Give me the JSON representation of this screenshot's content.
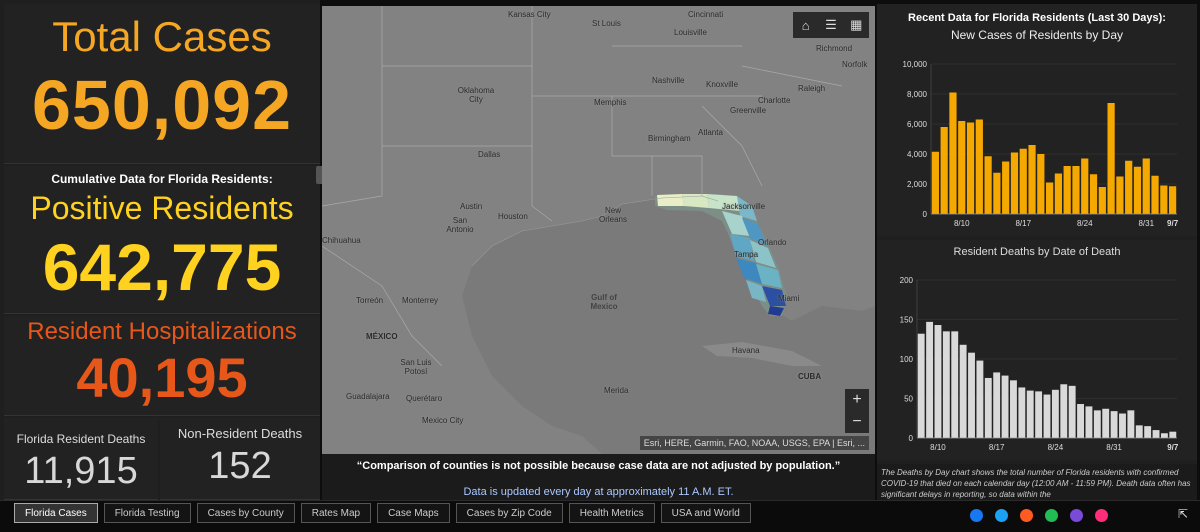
{
  "left": {
    "total_cases_label": "Total Cases",
    "total_cases_value": "650,092",
    "cumulative_label": "Cumulative Data for Florida Residents:",
    "positive_label": "Positive Residents",
    "positive_value": "642,775",
    "hosp_label": "Resident Hospitalizations",
    "hosp_value": "40,195",
    "fl_deaths_label": "Florida Resident Deaths",
    "fl_deaths_value": "11,915",
    "nonres_deaths_label": "Non-Resident Deaths",
    "nonres_deaths_value": "152"
  },
  "map": {
    "cities": [
      {
        "name": "Kansas City"
      },
      {
        "name": "St Louis"
      },
      {
        "name": "Cincinnati"
      },
      {
        "name": "Louisville"
      },
      {
        "name": "Richmond"
      },
      {
        "name": "Norfolk"
      },
      {
        "name": "Nashville"
      },
      {
        "name": "Knoxville"
      },
      {
        "name": "Raleigh"
      },
      {
        "name": "Charlotte"
      },
      {
        "name": "Greenville"
      },
      {
        "name": "Oklahoma City"
      },
      {
        "name": "Memphis"
      },
      {
        "name": "Birmingham"
      },
      {
        "name": "Atlanta"
      },
      {
        "name": "Dallas"
      },
      {
        "name": "Austin"
      },
      {
        "name": "Houston"
      },
      {
        "name": "San Antonio"
      },
      {
        "name": "New Orleans"
      },
      {
        "name": "Jacksonville"
      },
      {
        "name": "Orlando"
      },
      {
        "name": "Tampa"
      },
      {
        "name": "Miami"
      },
      {
        "name": "Torreón"
      },
      {
        "name": "Monterrey"
      },
      {
        "name": "MÉXICO"
      },
      {
        "name": "San Luis Potosí"
      },
      {
        "name": "Guadalajara"
      },
      {
        "name": "Querétaro"
      },
      {
        "name": "Mexico City"
      },
      {
        "name": "Havana"
      },
      {
        "name": "Merida"
      },
      {
        "name": "CUBA"
      },
      {
        "name": "Chihuahua"
      }
    ],
    "water_label": "Gulf of Mexico",
    "attribution": "Esri, HERE, Garmin, FAO, NOAA, USGS, EPA | Esri, ...",
    "zoom_in": "+",
    "zoom_out": "−"
  },
  "notes": {
    "quote": "“Comparison of counties is not possible because case data are not adjusted by population.”",
    "update": "Data is updated every day at approximately 11 A.M. ET."
  },
  "right": {
    "recent_title": "Recent Data for Florida Residents (Last 30 Days):",
    "chart1_title": "New Cases of Residents by Day",
    "chart2_title": "Resident Deaths by Date of Death",
    "description": "The Deaths by Day chart shows the total number of Florida residents with confirmed COVID-19 that died on each calendar day (12:00 AM - 11:59 PM). Death data often has significant delays in reporting, so data within the"
  },
  "chart_data": [
    {
      "type": "bar",
      "title": "New Cases of Residents by Day",
      "xlabel": "",
      "ylabel": "",
      "x_ticks": [
        "8/10",
        "8/17",
        "8/24",
        "8/31",
        "9/7"
      ],
      "y_ticks": [
        "0",
        "2,000",
        "4,000",
        "6,000",
        "8,000",
        "10,000"
      ],
      "ylim": [
        0,
        10000
      ],
      "color": "#f5a800",
      "values": [
        4150,
        5800,
        8100,
        6200,
        6100,
        6300,
        3850,
        2750,
        3500,
        4100,
        4350,
        4600,
        4000,
        2100,
        2700,
        3200,
        3200,
        3700,
        2650,
        1800,
        7400,
        2500,
        3550,
        3150,
        3700,
        2550,
        1900,
        1850
      ]
    },
    {
      "type": "bar",
      "title": "Resident Deaths by Date of Death",
      "xlabel": "",
      "ylabel": "",
      "x_ticks": [
        "8/10",
        "8/17",
        "8/24",
        "8/31",
        "9/7"
      ],
      "y_ticks": [
        "0",
        "50",
        "100",
        "150",
        "200"
      ],
      "ylim": [
        0,
        200
      ],
      "color": "#d9d9d9",
      "values": [
        132,
        147,
        143,
        135,
        135,
        118,
        108,
        98,
        76,
        83,
        79,
        73,
        64,
        60,
        59,
        55,
        61,
        68,
        66,
        43,
        40,
        35,
        37,
        34,
        31,
        35,
        16,
        15,
        10,
        6,
        8
      ]
    }
  ],
  "tabs": [
    "Florida Cases",
    "Florida Testing",
    "Cases by County",
    "Rates Map",
    "Case Maps",
    "Cases by Zip Code",
    "Health Metrics",
    "USA and World"
  ],
  "share_colors": [
    "#1877f2",
    "#1da1f2",
    "#ff5a1f",
    "#22bb55",
    "#7a4ad8",
    "#ff2d7a"
  ]
}
